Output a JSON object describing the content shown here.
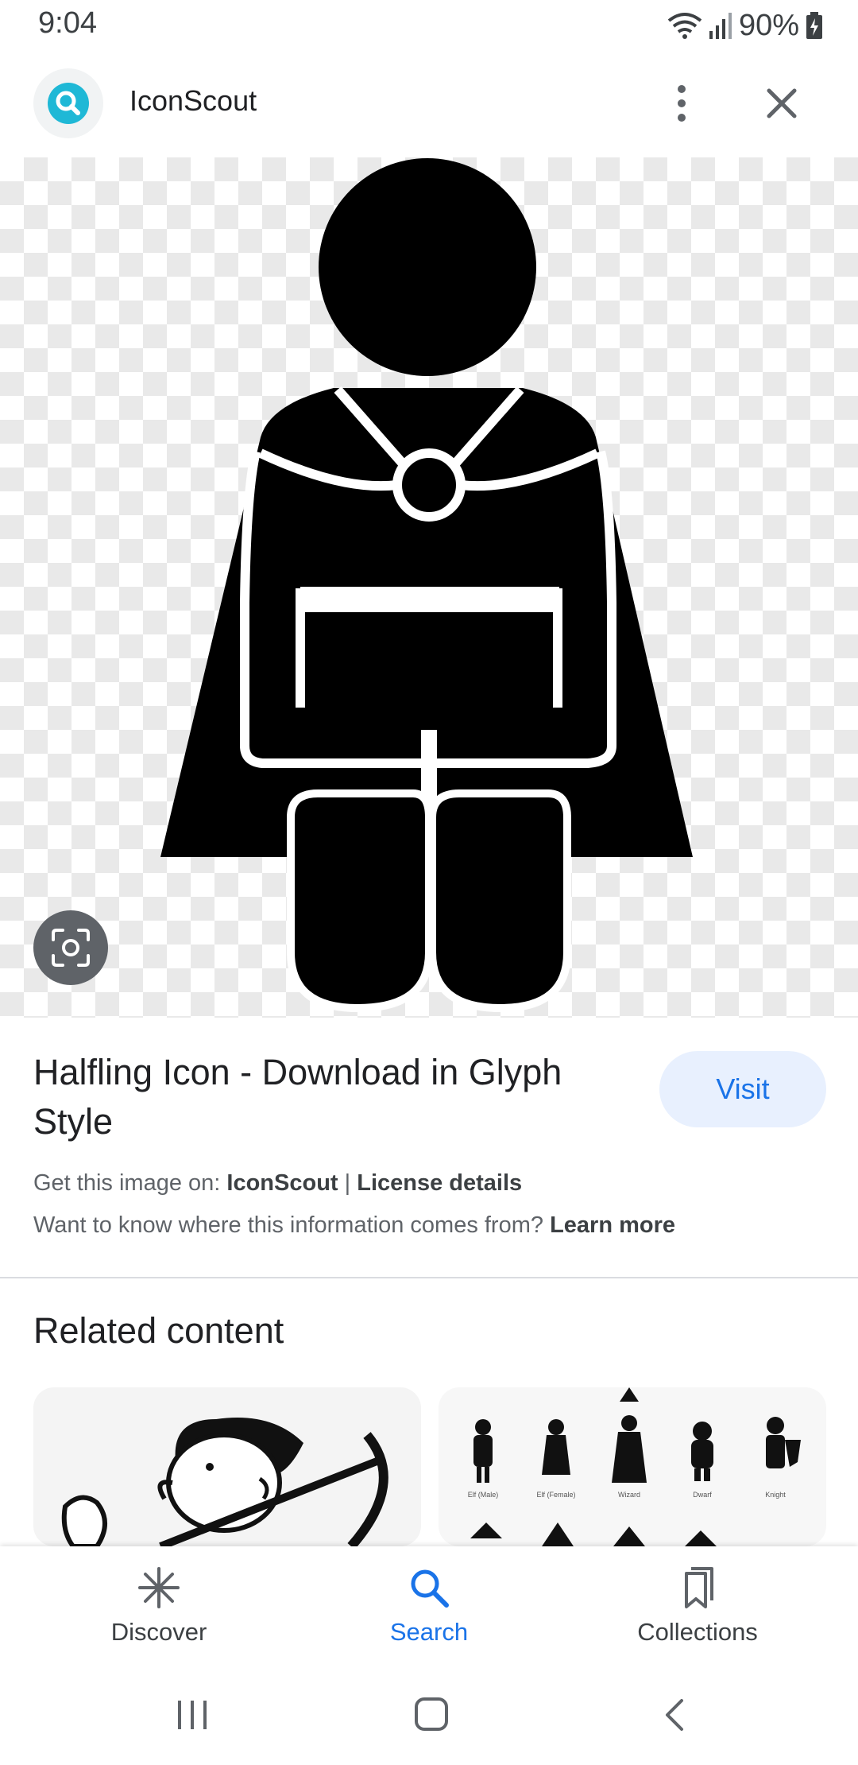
{
  "status_bar": {
    "time": "9:04",
    "battery": "90%"
  },
  "header": {
    "app_name": "IconScout",
    "icons": {
      "app": "magnifier-icon",
      "more": "more-vert-icon",
      "close": "close-icon"
    }
  },
  "result": {
    "title": "Halfling Icon - Download in Glyph Style",
    "visit_label": "Visit",
    "source_prefix": "Get this image on:",
    "source_name": "IconScout",
    "separator": "|",
    "license_label": "License details",
    "info_question": "Want to know where this information comes from?",
    "learn_more": "Learn more",
    "lens_icon": "lens-icon"
  },
  "related": {
    "heading": "Related content",
    "right_card_captions": [
      "Elf (Male)",
      "Elf (Female)",
      "Wizard",
      "Dwarf",
      "Knight"
    ]
  },
  "bottom_nav": {
    "items": [
      {
        "label": "Discover",
        "icon": "asterisk-icon",
        "active": false
      },
      {
        "label": "Search",
        "icon": "search-icon",
        "active": true
      },
      {
        "label": "Collections",
        "icon": "bookmarks-icon",
        "active": false
      }
    ]
  },
  "colors": {
    "accent": "#1a73e8",
    "visit_bg": "#e8f0fe",
    "app_icon": "#1fb8d6"
  }
}
